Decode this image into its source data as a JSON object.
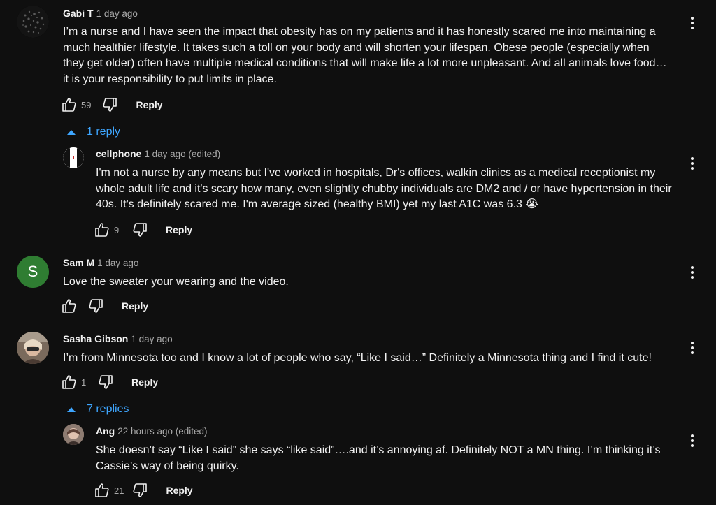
{
  "comments": [
    {
      "author": "Gabi T",
      "time": "1 day ago",
      "lines": [
        "I’m a nurse and I have seen the impact that obesity has on my patients and it has honestly scared me into maintaining a",
        "much healthier lifestyle. It takes such a toll on your body and will shorten your lifespan. Obese people (especially when",
        "they get older) often have multiple medical conditions that will make life a lot more unpleasant. And all animals love food…",
        "it is your responsibility to put limits in place."
      ],
      "likes": "59",
      "reply_label": "Reply",
      "replies_toggle": "1 reply",
      "replies": [
        {
          "author": "cellphone",
          "time": "1 day ago (edited)",
          "lines": [
            "I'm not a nurse by any means but I've worked in hospitals,  Dr's offices, walkin clinics as a medical receptionist my",
            "whole adult life and it's scary how many, even slightly chubby individuals are DM2 and / or have hypertension in their",
            "40s. It's definitely scared me. I'm average sized (healthy BMI) yet my last A1C was 6.3 😭"
          ],
          "likes": "9",
          "reply_label": "Reply"
        }
      ]
    },
    {
      "author": "Sam M",
      "time": "1 day ago",
      "avatar_letter": "S",
      "avatar_color": "#2f7d32",
      "lines": [
        "Love the sweater your wearing and the video."
      ],
      "likes": "",
      "reply_label": "Reply"
    },
    {
      "author": "Sasha Gibson",
      "time": "1 day ago",
      "lines": [
        "I’m from Minnesota too and I know a lot of people who say, “Like I said…” Definitely a Minnesota thing and I find it cute!"
      ],
      "likes": "1",
      "reply_label": "Reply",
      "replies_toggle": "7 replies",
      "replies": [
        {
          "author": "Ang",
          "time": "22 hours ago (edited)",
          "lines": [
            "She doesn’t say “Like I said” she says “like said”….and it’s annoying af.  Definitely NOT a MN thing.  I’m thinking it’s",
            "Cassie’s way of being quirky."
          ],
          "likes": "21",
          "reply_label": "Reply"
        }
      ]
    }
  ],
  "colors": {
    "background": "#0f0f0f",
    "link": "#3ea6ff",
    "secondary_text": "#aaaaaa"
  },
  "icons": [
    "thumb-up-icon",
    "thumb-down-icon",
    "more-vert-icon",
    "caret-up-icon"
  ]
}
